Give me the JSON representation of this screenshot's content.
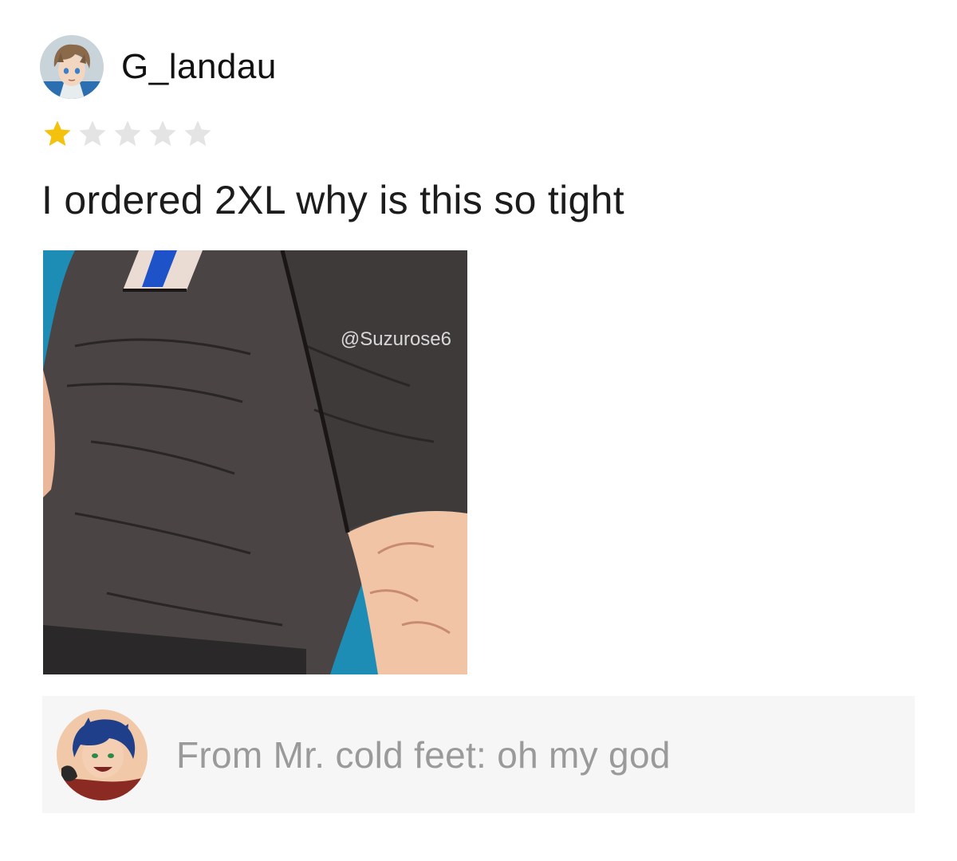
{
  "review": {
    "username": "G_landau",
    "rating": 1,
    "max_rating": 5,
    "text": "I ordered 2XL why is this so tight",
    "photo": {
      "watermark": "@Suzurose6"
    },
    "reply": {
      "text": "From Mr. cold feet: oh my god"
    }
  },
  "colors": {
    "star_filled": "#f4c20d",
    "star_empty": "#e4e4e4",
    "reply_background": "#f6f6f6",
    "reply_text": "#9a9a9a"
  },
  "icons": {
    "star_filled": "star-filled-icon",
    "star_empty": "star-empty-icon"
  }
}
